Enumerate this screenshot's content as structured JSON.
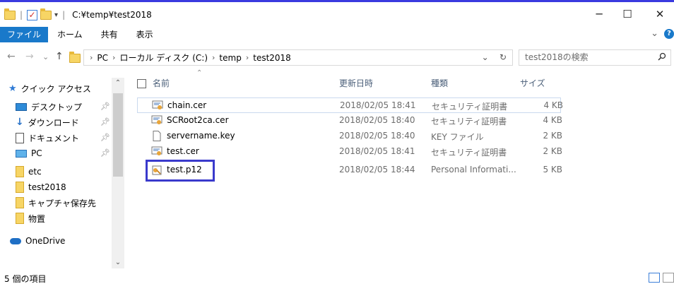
{
  "window": {
    "path_title": "C:¥temp¥test2018",
    "minimize": "─",
    "maximize": "☐",
    "close": "✕"
  },
  "ribbon": {
    "file_tab": "ファイル",
    "tabs": [
      "ホーム",
      "共有",
      "表示"
    ],
    "expand": "⌄"
  },
  "address": {
    "back": "←",
    "forward": "→",
    "recent": "⌄",
    "up": "↑",
    "crumbs": [
      "PC",
      "ローカル ディスク (C:)",
      "temp",
      "test2018"
    ],
    "dropdown": "⌄",
    "refresh": "↻"
  },
  "search": {
    "placeholder": "test2018の検索"
  },
  "nav_pane": {
    "items": [
      {
        "label": "クイック アクセス",
        "icon": "star-icon",
        "pinned": false
      },
      {
        "label": "デスクトップ",
        "icon": "desktop-icon",
        "pinned": true
      },
      {
        "label": "ダウンロード",
        "icon": "download-icon",
        "pinned": true
      },
      {
        "label": "ドキュメント",
        "icon": "document-icon",
        "pinned": true
      },
      {
        "label": "PC",
        "icon": "pc-icon",
        "pinned": true
      },
      {
        "label": "etc",
        "icon": "folder-icon",
        "pinned": false
      },
      {
        "label": "test2018",
        "icon": "folder-icon",
        "pinned": false
      },
      {
        "label": "キャプチャ保存先",
        "icon": "folder-icon",
        "pinned": false
      },
      {
        "label": "物置",
        "icon": "folder-icon",
        "pinned": false
      },
      {
        "label": "OneDrive",
        "icon": "cloud-icon",
        "pinned": false
      }
    ]
  },
  "columns": {
    "name": "名前",
    "date": "更新日時",
    "type": "種類",
    "size": "サイズ"
  },
  "files": [
    {
      "name": "chain.cer",
      "date": "2018/02/05 18:41",
      "type": "セキュリティ証明書",
      "size": "4 KB",
      "icon": "certificate-icon",
      "selected": true
    },
    {
      "name": "SCRoot2ca.cer",
      "date": "2018/02/05 18:40",
      "type": "セキュリティ証明書",
      "size": "4 KB",
      "icon": "certificate-icon",
      "selected": false
    },
    {
      "name": "servername.key",
      "date": "2018/02/05 18:40",
      "type": "KEY ファイル",
      "size": "2 KB",
      "icon": "blank-file-icon",
      "selected": false
    },
    {
      "name": "test.cer",
      "date": "2018/02/05 18:41",
      "type": "セキュリティ証明書",
      "size": "2 KB",
      "icon": "certificate-icon",
      "selected": false
    },
    {
      "name": "test.p12",
      "date": "2018/02/05 18:44",
      "type": "Personal Informati...",
      "size": "5 KB",
      "icon": "pfx-key-icon",
      "selected": false
    }
  ],
  "status": {
    "item_count": "5 個の項目"
  },
  "colors": {
    "file_tab": "#1979ca",
    "highlight_box": "#3a3acc",
    "folder": "#f7d565"
  }
}
